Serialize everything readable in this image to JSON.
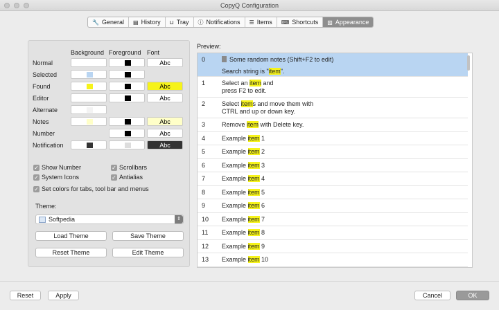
{
  "window": {
    "title": "CopyQ Configuration"
  },
  "tabs": [
    {
      "label": "General",
      "icon": "wrench-icon",
      "glyph": "🔧"
    },
    {
      "label": "History",
      "icon": "history-icon",
      "glyph": "▤"
    },
    {
      "label": "Tray",
      "icon": "tray-icon",
      "glyph": "⊔"
    },
    {
      "label": "Notifications",
      "icon": "info-icon",
      "glyph": "ⓘ"
    },
    {
      "label": "Items",
      "icon": "list-icon",
      "glyph": "☰"
    },
    {
      "label": "Shortcuts",
      "icon": "keyboard-icon",
      "glyph": "⌨"
    },
    {
      "label": "Appearance",
      "icon": "appearance-icon",
      "glyph": "▨"
    }
  ],
  "colors": {
    "headers": {
      "background": "Background",
      "foreground": "Foreground",
      "font": "Font"
    },
    "rows": [
      {
        "label": "Normal",
        "bg": "#ffffff",
        "fg": "#000000",
        "font": "Abc",
        "font_bg": "#ffffff",
        "font_fg": "#000000"
      },
      {
        "label": "Selected",
        "bg": "#b9d5f2",
        "fg": "#000000",
        "font": "",
        "font_bg": "",
        "font_fg": ""
      },
      {
        "label": "Found",
        "bg": "#f6f31a",
        "fg": "#000000",
        "font": "Abc",
        "font_bg": "#f6f31a",
        "font_fg": "#000000"
      },
      {
        "label": "Editor",
        "bg": "#ffffff",
        "fg": "#000000",
        "font": "Abc",
        "font_bg": "#ffffff",
        "font_fg": "#000000"
      },
      {
        "label": "Alternate",
        "bg": "#f3f3f3",
        "fg": "",
        "font": "",
        "font_bg": "",
        "font_fg": ""
      },
      {
        "label": "Notes",
        "bg": "#ffffc8",
        "fg": "#000000",
        "font": "Abc",
        "font_bg": "#ffffc8",
        "font_fg": "#000000"
      },
      {
        "label": "Number",
        "bg": "",
        "fg": "#000000",
        "font": "Abc",
        "font_bg": "#ffffff",
        "font_fg": "#000000"
      },
      {
        "label": "Notification",
        "bg": "#333333",
        "fg": "#dddddd",
        "font": "Abc",
        "font_bg": "#333333",
        "font_fg": "#ffffff"
      }
    ]
  },
  "options": {
    "show_number": "Show Number",
    "scrollbars": "Scrollbars",
    "system_icons": "System Icons",
    "antialias": "Antialias",
    "set_colors": "Set colors for tabs, tool bar and menus"
  },
  "theme": {
    "label": "Theme:",
    "selected": "Softpedia",
    "load": "Load Theme",
    "save": "Save Theme",
    "reset": "Reset Theme",
    "edit": "Edit Theme"
  },
  "preview": {
    "label": "Preview:",
    "items": [
      {
        "num": "0",
        "parts": [
          {
            "t": "Some random notes (Shift+F2 to edit)"
          }
        ],
        "line2": [
          {
            "t": "Search string is \""
          },
          {
            "t": "item",
            "h": true
          },
          {
            "t": "\"."
          }
        ],
        "selected": true,
        "note": true
      },
      {
        "num": "1",
        "parts": [
          {
            "t": "Select an "
          },
          {
            "t": "item",
            "h": true
          },
          {
            "t": " and"
          }
        ],
        "line2": [
          {
            "t": "press F2 to edit."
          }
        ]
      },
      {
        "num": "2",
        "parts": [
          {
            "t": "Select "
          },
          {
            "t": "item",
            "h": true
          },
          {
            "t": "s and move them with"
          }
        ],
        "line2": [
          {
            "t": "CTRL and up or down key."
          }
        ]
      },
      {
        "num": "3",
        "parts": [
          {
            "t": "Remove "
          },
          {
            "t": "item",
            "h": true
          },
          {
            "t": " with Delete key."
          }
        ]
      },
      {
        "num": "4",
        "parts": [
          {
            "t": "Example "
          },
          {
            "t": "item",
            "h": true
          },
          {
            "t": " 1"
          }
        ]
      },
      {
        "num": "5",
        "parts": [
          {
            "t": "Example "
          },
          {
            "t": "item",
            "h": true
          },
          {
            "t": " 2"
          }
        ]
      },
      {
        "num": "6",
        "parts": [
          {
            "t": "Example "
          },
          {
            "t": "item",
            "h": true
          },
          {
            "t": " 3"
          }
        ]
      },
      {
        "num": "7",
        "parts": [
          {
            "t": "Example "
          },
          {
            "t": "item",
            "h": true
          },
          {
            "t": " 4"
          }
        ]
      },
      {
        "num": "8",
        "parts": [
          {
            "t": "Example "
          },
          {
            "t": "item",
            "h": true
          },
          {
            "t": " 5"
          }
        ]
      },
      {
        "num": "9",
        "parts": [
          {
            "t": "Example "
          },
          {
            "t": "item",
            "h": true
          },
          {
            "t": " 6"
          }
        ]
      },
      {
        "num": "10",
        "parts": [
          {
            "t": "Example "
          },
          {
            "t": "item",
            "h": true
          },
          {
            "t": " 7"
          }
        ]
      },
      {
        "num": "11",
        "parts": [
          {
            "t": "Example "
          },
          {
            "t": "item",
            "h": true
          },
          {
            "t": " 8"
          }
        ]
      },
      {
        "num": "12",
        "parts": [
          {
            "t": "Example "
          },
          {
            "t": "item",
            "h": true
          },
          {
            "t": " 9"
          }
        ]
      },
      {
        "num": "13",
        "parts": [
          {
            "t": "Example "
          },
          {
            "t": "item",
            "h": true
          },
          {
            "t": " 10"
          }
        ]
      }
    ]
  },
  "footer": {
    "reset": "Reset",
    "apply": "Apply",
    "cancel": "Cancel",
    "ok": "OK"
  }
}
